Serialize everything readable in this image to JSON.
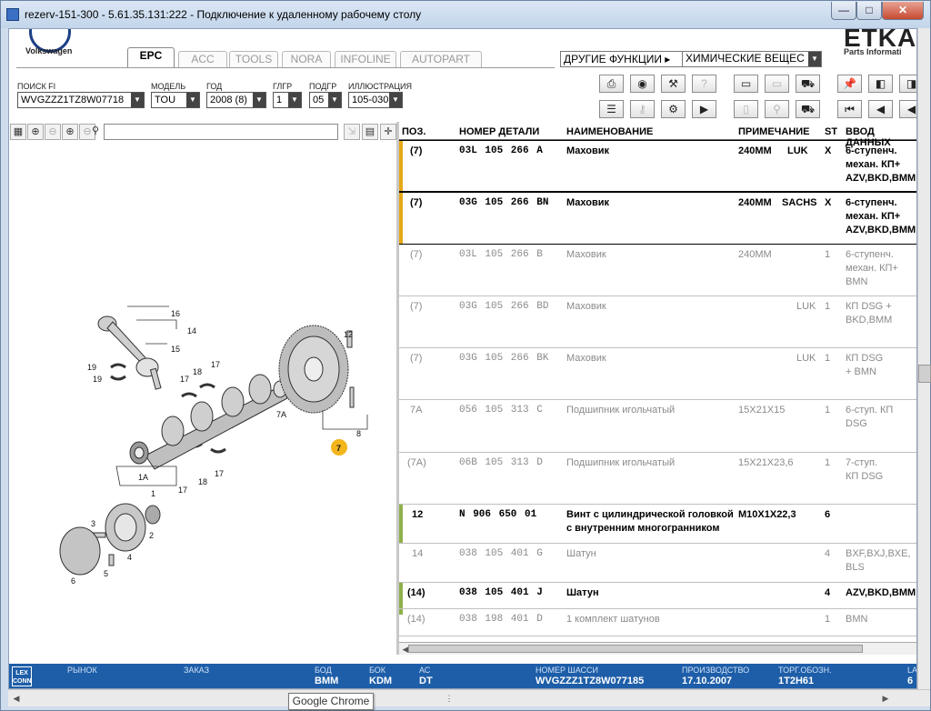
{
  "window": {
    "title": "rezerv-151-300 - 5.61.35.131:222 - Подключение к удаленному рабочему столу",
    "min": "—",
    "max": "□",
    "close": "✕"
  },
  "taskbar_tooltip": "Google Chrome",
  "brand": {
    "vw_text": "Volkswagen",
    "etka": "ETKA",
    "etka_sub": "Parts Informati"
  },
  "tabs": [
    "EPC",
    "ACC",
    "TOOLS",
    "NORA",
    "INFOLINE",
    "AUTOPART"
  ],
  "other_functions": {
    "label": "ДРУГИЕ ФУНКЦИИ ▸",
    "value": "ХИМИЧЕСКИЕ ВЕЩЕС"
  },
  "filters": [
    {
      "label": "ПОИСК FI",
      "value": "WVGZZZ1TZ8W07718"
    },
    {
      "label": "МОДЕЛЬ",
      "value": "TOU"
    },
    {
      "label": "ГОД",
      "value": "2008 (8)"
    },
    {
      "label": "ГЛГР",
      "value": "1"
    },
    {
      "label": "ПОДГР",
      "value": "05"
    },
    {
      "label": "ИЛЛЮСТРАЦИЯ",
      "value": "105-030"
    }
  ],
  "table": {
    "headers": {
      "pos": "ПОЗ.",
      "part": "НОМЕР ДЕТАЛИ",
      "name": "НАИМЕНОВАНИЕ",
      "note": "ПРИМЕЧАНИЕ",
      "st": "ST",
      "input": "ВВОД ДАННЫХ"
    },
    "rows": [
      {
        "pos": "(7)",
        "part": "03L 105 266 A",
        "name": "Маховик",
        "note": "240MM",
        "note2": "LUK",
        "st": "X",
        "input": "6-ступенч. механ. КП+ AZV,BKD,BMM"
      },
      {
        "pos": "(7)",
        "part": "03G 105 266 BN",
        "name": "Маховик",
        "note": "240MM",
        "note2": "SACHS",
        "st": "X",
        "input": "6-ступенч. механ. КП+ AZV,BKD,BMM"
      },
      {
        "pos": "(7)",
        "part": "03L 105 266 B",
        "name": "Маховик",
        "note": "240MM",
        "note2": "",
        "st": "1",
        "input": "6-ступенч. механ. КП+ BMN"
      },
      {
        "pos": "(7)",
        "part": "03G 105 266 BD",
        "name": "Маховик",
        "note": "",
        "note2": "LUK",
        "st": "1",
        "input": "КП DSG + BKD,BMM"
      },
      {
        "pos": "(7)",
        "part": "03G 105 266 BK",
        "name": "Маховик",
        "note": "",
        "note2": "LUK",
        "st": "1",
        "input": "КП DSG + BMN"
      },
      {
        "pos": "7A",
        "part": "056 105 313 C",
        "name": "Подшипник игольчатый",
        "note": "15X21X15",
        "note2": "",
        "st": "1",
        "input": "6-ступ. КП DSG"
      },
      {
        "pos": "(7A)",
        "part": "06B 105 313 D",
        "name": "Подшипник игольчатый",
        "note": "15X21X23,6",
        "note2": "",
        "st": "1",
        "input": "7-ступ. КП DSG"
      },
      {
        "pos": "12",
        "part": "N 906 650 01",
        "name": "Винт с цилиндрической головкой с внутренним многогранником",
        "note": "M10X1X22,3",
        "note2": "",
        "st": "6",
        "input": ""
      },
      {
        "pos": "14",
        "part": "038 105 401 G",
        "name": "Шатун",
        "note": "",
        "note2": "",
        "st": "4",
        "input": "BXF,BXJ,BXE, BLS"
      },
      {
        "pos": "(14)",
        "part": "038 105 401 J",
        "name": "Шатун",
        "note": "",
        "note2": "",
        "st": "4",
        "input": "AZV,BKD,BMM"
      },
      {
        "pos": "(14)",
        "part": "038 198 401 D",
        "name": "1 комплект шатунов",
        "note": "",
        "note2": "",
        "st": "1",
        "input": "BMN"
      }
    ]
  },
  "diagram_labels": [
    "16",
    "14",
    "15",
    "19",
    "19",
    "17",
    "18",
    "17",
    "12",
    "7A",
    "7",
    "8",
    "1A",
    "1",
    "17",
    "18",
    "17",
    "3",
    "2",
    "4",
    "5",
    "6"
  ],
  "status": {
    "lex": "LEX CONN",
    "items": [
      {
        "label": "РЫНОК",
        "value": ""
      },
      {
        "label": "ЗАКАЗ",
        "value": ""
      },
      {
        "label": "БОД",
        "value": "BMM"
      },
      {
        "label": "БОК",
        "value": "KDM"
      },
      {
        "label": "АС",
        "value": "DT"
      },
      {
        "label": "НОМЕР ШАССИ",
        "value": "WVGZZZ1TZ8W077185"
      },
      {
        "label": "ПРОИЗВОДСТВО",
        "value": "17.10.2007"
      },
      {
        "label": "ТОРГ.ОБОЗН.",
        "value": "1T2H61"
      },
      {
        "label": "LA",
        "value": "6"
      }
    ]
  },
  "colors": {
    "status_bg": "#1e5ea8",
    "mark_yellow": "#e6a817",
    "mark_green": "#8fb04a",
    "callout": "#f2b51c"
  }
}
